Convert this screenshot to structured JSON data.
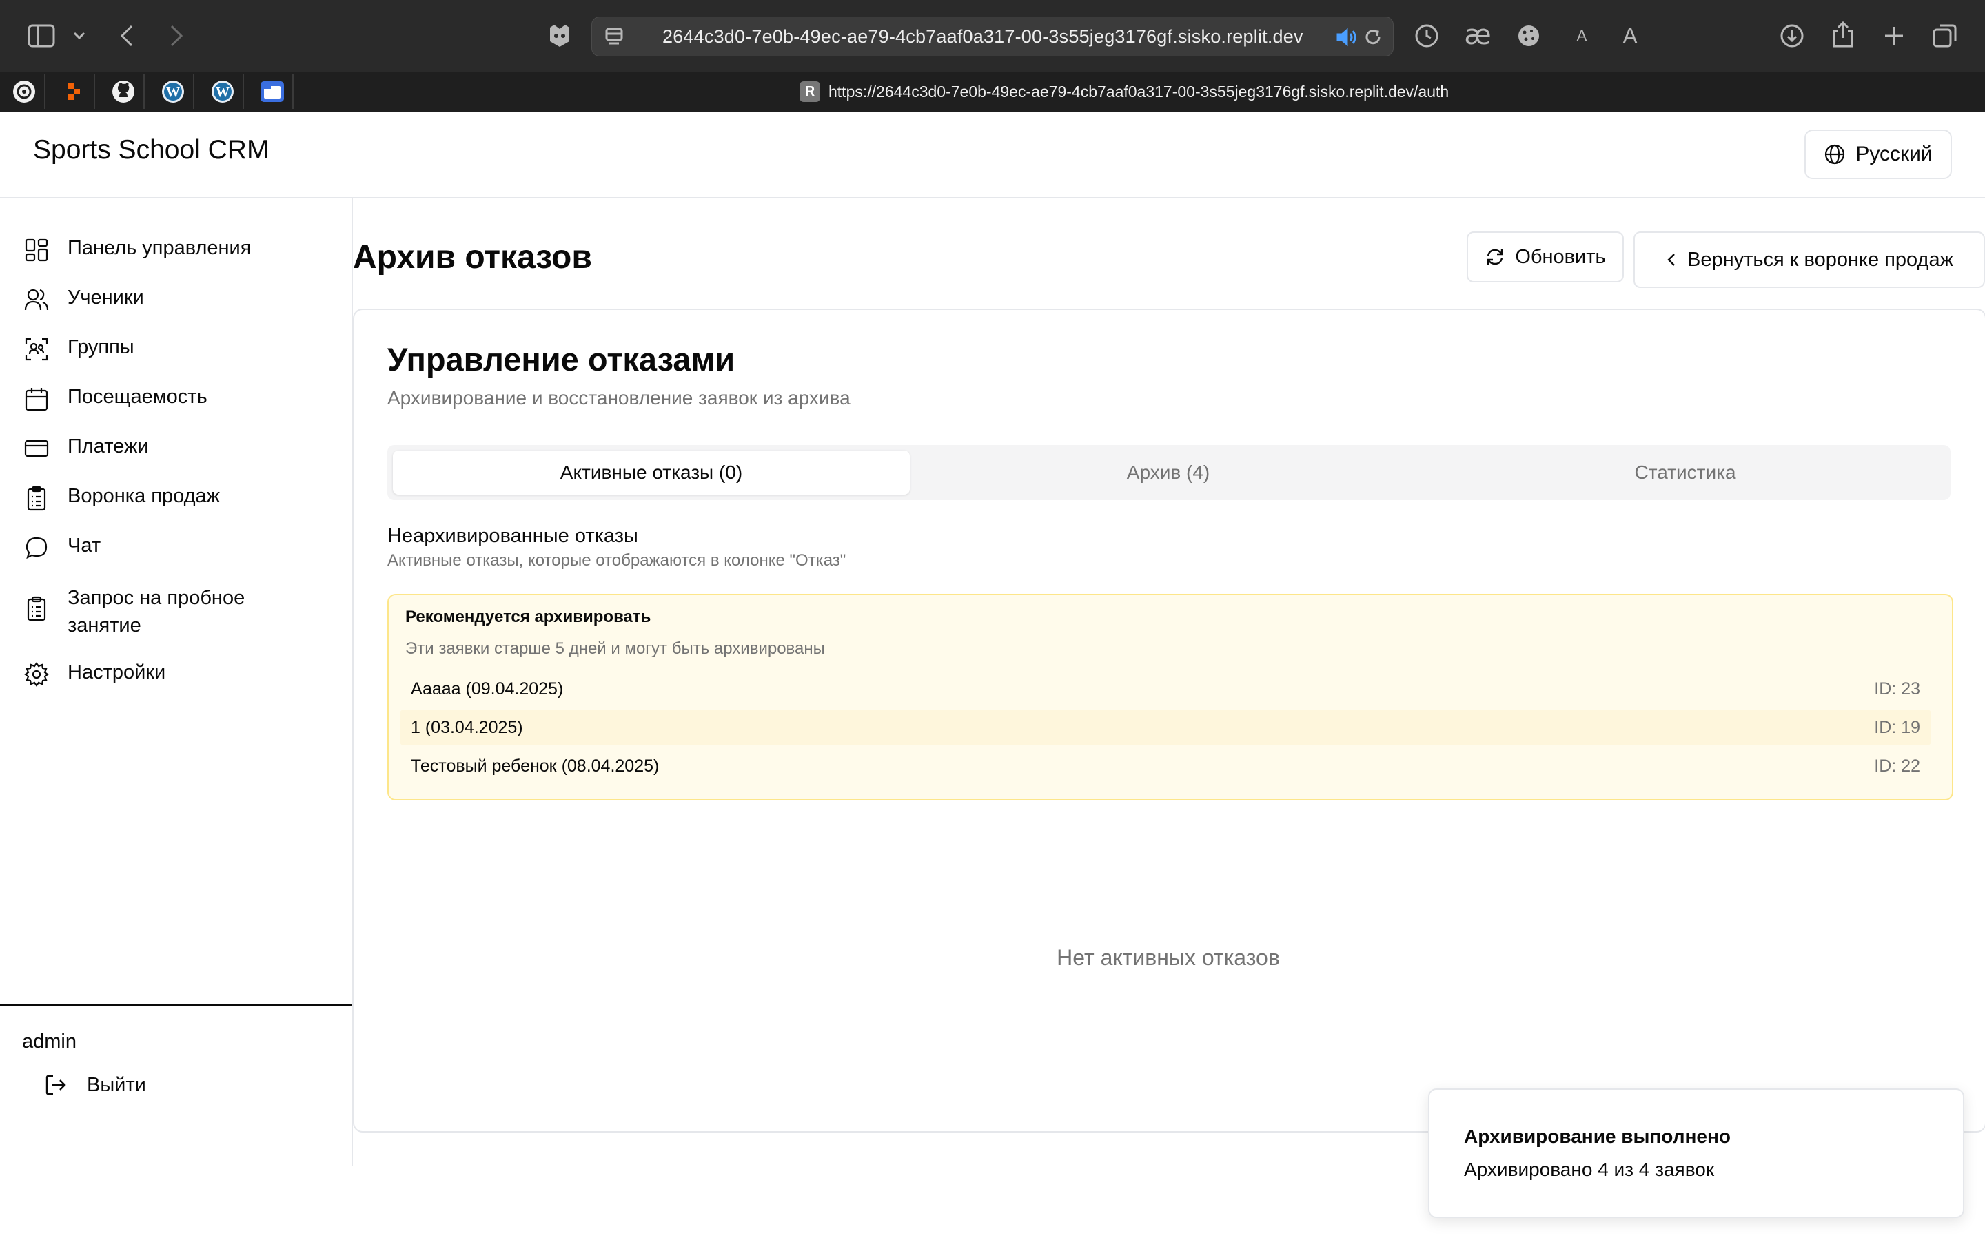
{
  "browser": {
    "url": "2644c3d0-7e0b-49ec-ae79-4cb7aaf0a317-00-3s55jeg3176gf.sisko.replit.dev",
    "hover_url": "https://2644c3d0-7e0b-49ec-ae79-4cb7aaf0a317-00-3s55jeg3176gf.sisko.replit.dev/auth",
    "hover_badge": "R",
    "text_size_small": "A",
    "text_size_large": "A",
    "bookmarks": [
      "openai-icon",
      "replit-icon",
      "github-icon",
      "wordpress-icon",
      "wordpress-icon",
      "folder-icon"
    ]
  },
  "header": {
    "app_title": "Sports School CRM",
    "language": "Русский"
  },
  "sidebar": {
    "items": [
      {
        "label": "Панель управления",
        "icon": "dashboard-icon"
      },
      {
        "label": "Ученики",
        "icon": "users-icon"
      },
      {
        "label": "Группы",
        "icon": "groups-icon"
      },
      {
        "label": "Посещаемость",
        "icon": "calendar-icon"
      },
      {
        "label": "Платежи",
        "icon": "credit-card-icon"
      },
      {
        "label": "Воронка продаж",
        "icon": "clipboard-icon"
      },
      {
        "label": "Чат",
        "icon": "chat-icon"
      },
      {
        "label": "Запрос на пробное",
        "label_2": "занятие",
        "icon": "clipboard-icon"
      },
      {
        "label": "Настройки",
        "icon": "gear-icon"
      }
    ],
    "user": "admin",
    "logout": "Выйти"
  },
  "page": {
    "title": "Архив отказов",
    "refresh_button": "Обновить",
    "back_button": "Вернуться к воронке продаж"
  },
  "card": {
    "title": "Управление отказами",
    "description": "Архивирование и восстановление заявок из архива",
    "tabs": [
      {
        "label": "Активные отказы (0)",
        "active": true
      },
      {
        "label": "Архив (4)",
        "active": false
      },
      {
        "label": "Статистика",
        "active": false
      }
    ],
    "section_title": "Неархивированные отказы",
    "section_description": "Активные отказы, которые отображаются в колонке \"Отказ\"",
    "recommend": {
      "title": "Рекомендуется архивировать",
      "description": "Эти заявки старше 5 дней и могут быть архивированы",
      "rows": [
        {
          "name": "Ааааа (09.04.2025)",
          "id": "ID: 23"
        },
        {
          "name": "1 (03.04.2025)",
          "id": "ID: 19"
        },
        {
          "name": "Тестовый ребенок (08.04.2025)",
          "id": "ID: 22"
        }
      ]
    },
    "empty_text": "Нет активных отказов"
  },
  "toast": {
    "title": "Архивирование выполнено",
    "description": "Архивировано 4 из 4 заявок"
  },
  "colors": {
    "chrome_bg": "#2a2a2a",
    "recommend_bg": "#fffbeb",
    "recommend_border": "#fde68a",
    "muted_text": "#737373"
  }
}
